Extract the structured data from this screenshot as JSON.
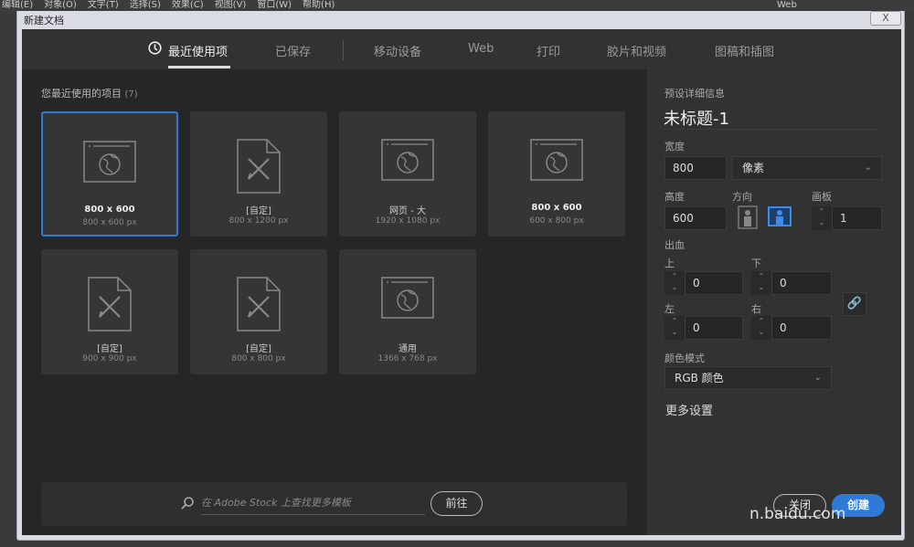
{
  "menubar": {
    "items": [
      "编辑(E)",
      "对象(O)",
      "文字(T)",
      "选择(S)",
      "效果(C)",
      "视图(V)",
      "窗口(W)",
      "帮助(H)"
    ],
    "workspace": "Web"
  },
  "window": {
    "title": "新建文档",
    "close": "X"
  },
  "tabs": [
    {
      "label": "最近使用项",
      "icon": "clock-icon",
      "active": true
    },
    {
      "label": "已保存"
    },
    {
      "label": "移动设备"
    },
    {
      "label": "Web"
    },
    {
      "label": "打印"
    },
    {
      "label": "胶片和视频"
    },
    {
      "label": "图稿和插图"
    }
  ],
  "recent": {
    "heading": "您最近使用的项目",
    "count": "(7)",
    "items": [
      {
        "name": "800 x 600",
        "size": "800 x 600 px",
        "icon": "web-icon",
        "selected": true
      },
      {
        "name": "[自定]",
        "size": "800 x 1200 px",
        "icon": "custom-document-icon"
      },
      {
        "name": "网页 - 大",
        "size": "1920 x 1080 px",
        "icon": "web-icon"
      },
      {
        "name": "800 x 600",
        "size": "600 x 800 px",
        "icon": "web-icon"
      },
      {
        "name": "[自定]",
        "size": "900 x 900 px",
        "icon": "custom-document-icon"
      },
      {
        "name": "[自定]",
        "size": "800 x 800 px",
        "icon": "custom-document-icon"
      },
      {
        "name": "通用",
        "size": "1366 x 768 px",
        "icon": "web-icon"
      }
    ]
  },
  "search": {
    "placeholder": "在 Adobe Stock 上查找更多模板",
    "go": "前往"
  },
  "details": {
    "heading": "预设详细信息",
    "name": "未标题-1",
    "width_label": "宽度",
    "width": "800",
    "unit": "像素",
    "height_label": "高度",
    "height": "600",
    "orientation_label": "方向",
    "artboard_label": "画板",
    "artboards": "1",
    "bleed_label": "出血",
    "top_label": "上",
    "top": "0",
    "bottom_label": "下",
    "bottom": "0",
    "left_label": "左",
    "left": "0",
    "right_label": "右",
    "right": "0",
    "color_mode_label": "颜色模式",
    "color_mode": "RGB 颜色",
    "more": "更多设置",
    "close": "关闭",
    "create": "创建",
    "accent": "#2f7ad8"
  },
  "watermark": "n.baidu.com"
}
